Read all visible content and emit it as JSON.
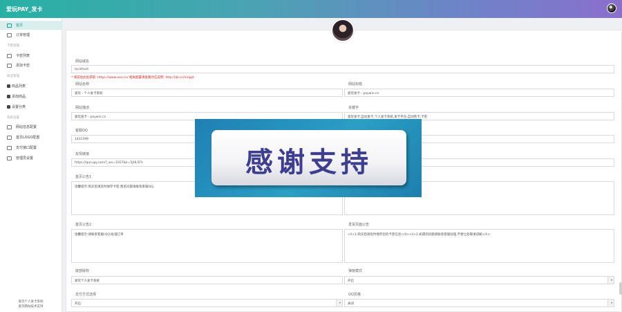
{
  "header": {
    "brand": "爱玩PAY_发卡"
  },
  "sidebar": {
    "items": [
      {
        "label": "首页",
        "icon": "home-icon"
      },
      {
        "label": "订单管理",
        "icon": "order-icon"
      },
      {
        "label": "卡密列表",
        "icon": "card-list-icon"
      },
      {
        "label": "添加卡密",
        "icon": "add-card-icon"
      },
      {
        "label": "商品列表",
        "icon": "goods-list-icon"
      },
      {
        "label": "添加商品",
        "icon": "add-goods-icon"
      },
      {
        "label": "设置分类",
        "icon": "category-icon"
      },
      {
        "label": "网站信息配置",
        "icon": "site-info-icon"
      },
      {
        "label": "首页LOGO配置",
        "icon": "logo-icon"
      },
      {
        "label": "支付接口配置",
        "icon": "payment-icon"
      },
      {
        "label": "管理员设置",
        "icon": "admin-icon"
      }
    ],
    "groups": [
      "卡密管理",
      "商品管理",
      "系统设置"
    ],
    "footer": [
      "爱玩个人发卡系统",
      "爱玩网站技术支持"
    ]
  },
  "form": {
    "domain_label": "网站域名",
    "domain_value": "localhost",
    "hint": "* 请前往此处获取: https://www.xxx.cn/ 相关配置请查看对应说明: http://ibl.cc/nnlppt",
    "site_name_label": "网站名称",
    "site_name_value": "爱玩 - 个人发卡系统",
    "site_title_label": "网站标题",
    "site_title_value": "爱玩发卡 - paywin.cn",
    "site_desc_label": "网站描述",
    "site_desc_value": "爱玩发卡 - paywin.cn",
    "keywords_label": "关键字",
    "keywords_value": "爱玩发卡,自动发卡,个人发卡系统,发卡平台,自动售卡,卡密",
    "qq_label": "客服QQ",
    "qq_value": "1431599",
    "friend_link_label": "友情链接",
    "friend_link_value": "https://qun.qq.com/?_wv=1027&k=5JHL5Fh",
    "notice1_label": "首页公告1",
    "notice1_value": "温馨提示:购买后请及时保存卡密,售后问题请联系客服QQ。",
    "notice1b_value": "客服电话:自动发货请联系客服",
    "notice2_label": "首页公告2",
    "notice2_value": "温馨提示:请联系客服(QQ)处理订单",
    "notice3_label": "发货页面公告",
    "notice3_value": "<li>1.购买后请及时保存您的卡密信息</li><li>2.如遇到问题请联系客服处理,不便之处敬请谅解</li>",
    "copyright_label": "底部版权",
    "copyright_value": "爱玩个人发卡系统",
    "switch_label": "弹窗模式",
    "switch_value": "开启",
    "mode_label": "支付方式选择",
    "mode_value": "开启",
    "qq_style_label": "QQ风格",
    "qq_style_value": "关闭"
  },
  "overlay": {
    "text": "感谢支持"
  },
  "colors": {
    "header_start": "#27b1a4",
    "header_end": "#8a6fcd",
    "accent": "#1a9a8e",
    "hint": "#e02020",
    "banner_text": "#3d3d92"
  }
}
